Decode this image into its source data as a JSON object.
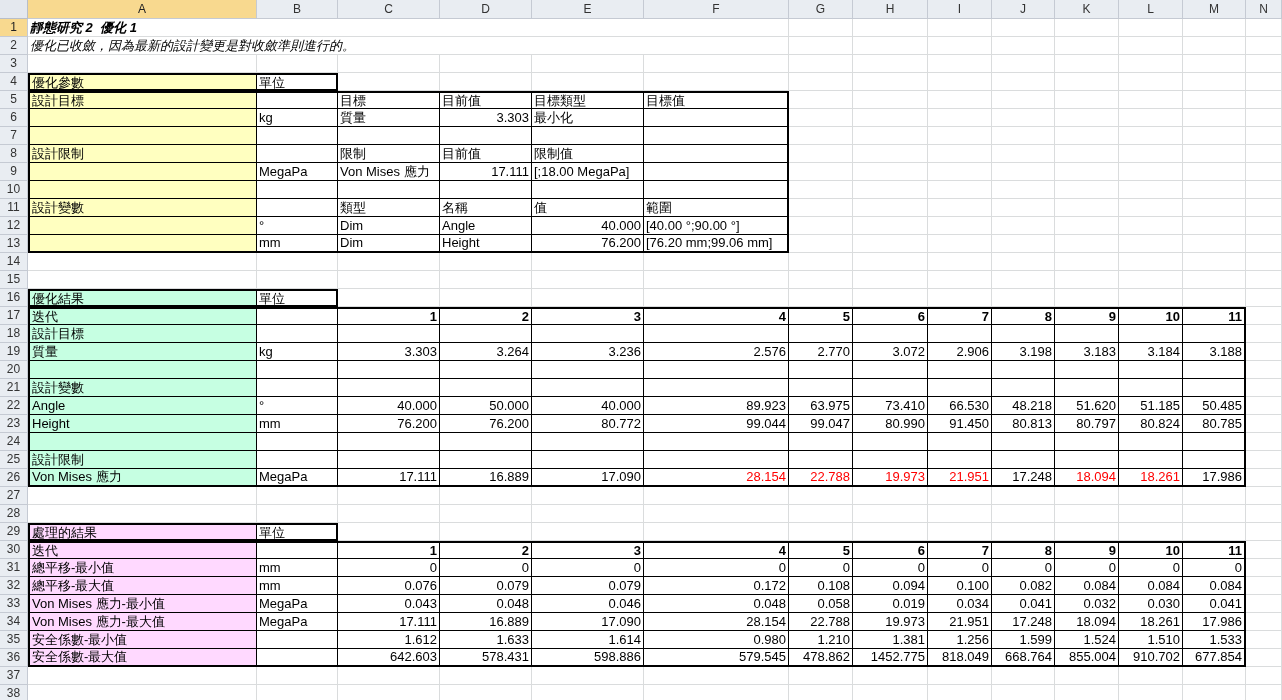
{
  "column_headers": [
    {
      "label": "A",
      "selected": true
    },
    {
      "label": "B",
      "selected": false
    },
    {
      "label": "C",
      "selected": false
    },
    {
      "label": "D",
      "selected": false
    },
    {
      "label": "E",
      "selected": false
    },
    {
      "label": "F",
      "selected": false
    },
    {
      "label": "G",
      "selected": false
    },
    {
      "label": "H",
      "selected": false
    },
    {
      "label": "I",
      "selected": false
    },
    {
      "label": "J",
      "selected": false
    },
    {
      "label": "K",
      "selected": false
    },
    {
      "label": "L",
      "selected": false
    },
    {
      "label": "M",
      "selected": false
    },
    {
      "label": "N",
      "selected": false
    }
  ],
  "row_numbers": [
    {
      "label": "1",
      "selected": true
    },
    {
      "label": "2",
      "selected": false
    },
    {
      "label": "3",
      "selected": false
    },
    {
      "label": "4",
      "selected": false
    },
    {
      "label": "5",
      "selected": false
    },
    {
      "label": "6",
      "selected": false
    },
    {
      "label": "7",
      "selected": false
    },
    {
      "label": "8",
      "selected": false
    },
    {
      "label": "9",
      "selected": false
    },
    {
      "label": "10",
      "selected": false
    },
    {
      "label": "11",
      "selected": false
    },
    {
      "label": "12",
      "selected": false
    },
    {
      "label": "13",
      "selected": false
    },
    {
      "label": "14",
      "selected": false
    },
    {
      "label": "15",
      "selected": false
    },
    {
      "label": "16",
      "selected": false
    },
    {
      "label": "17",
      "selected": false
    },
    {
      "label": "18",
      "selected": false
    },
    {
      "label": "19",
      "selected": false
    },
    {
      "label": "20",
      "selected": false
    },
    {
      "label": "21",
      "selected": false
    },
    {
      "label": "22",
      "selected": false
    },
    {
      "label": "23",
      "selected": false
    },
    {
      "label": "24",
      "selected": false
    },
    {
      "label": "25",
      "selected": false
    },
    {
      "label": "26",
      "selected": false
    },
    {
      "label": "27",
      "selected": false
    },
    {
      "label": "28",
      "selected": false
    },
    {
      "label": "29",
      "selected": false
    },
    {
      "label": "30",
      "selected": false
    },
    {
      "label": "31",
      "selected": false
    },
    {
      "label": "32",
      "selected": false
    },
    {
      "label": "33",
      "selected": false
    },
    {
      "label": "34",
      "selected": false
    },
    {
      "label": "35",
      "selected": false
    },
    {
      "label": "36",
      "selected": false
    },
    {
      "label": "37",
      "selected": false
    },
    {
      "label": "38",
      "selected": false
    }
  ],
  "title": "靜態研究 2  優化 1",
  "message": "優化已收斂，因為最新的設計變更是對收斂準則進行的。",
  "sections": [
    {
      "kind": "parameters",
      "color": "#ffffc0",
      "label": "優化參數",
      "unit": "單位",
      "rows": [
        {
          "label": "設計目標",
          "cells": [
            {
              "kind": "text",
              "text": "目標"
            },
            {
              "kind": "text",
              "text": "目前值"
            },
            {
              "kind": "text",
              "text": "目標類型"
            },
            {
              "kind": "text",
              "text": "目標值"
            }
          ]
        },
        {
          "unit": "kg",
          "cells": [
            {
              "kind": "text",
              "text": "質量"
            },
            {
              "kind": "number",
              "text": "3.303"
            },
            {
              "kind": "text",
              "text": "最小化"
            }
          ]
        },
        {},
        {
          "label": "設計限制",
          "cells": [
            {
              "kind": "text",
              "text": "限制"
            },
            {
              "kind": "text",
              "text": "目前值"
            },
            {
              "kind": "text",
              "text": "限制值"
            }
          ]
        },
        {
          "unit": "MegaPa",
          "cells": [
            {
              "kind": "text",
              "text": "Von Mises 應力"
            },
            {
              "kind": "number",
              "text": "17.111"
            },
            {
              "kind": "text",
              "text": "[;18.00 MegaPa]"
            }
          ]
        },
        {},
        {
          "label": "設計變數",
          "cells": [
            {
              "kind": "text",
              "text": "類型"
            },
            {
              "kind": "text",
              "text": "名稱"
            },
            {
              "kind": "text",
              "text": "值"
            },
            {
              "kind": "text",
              "text": "範圍"
            }
          ]
        },
        {
          "unit": "°",
          "cells": [
            {
              "kind": "text",
              "text": "Dim"
            },
            {
              "kind": "text",
              "text": "Angle"
            },
            {
              "kind": "number",
              "text": "40.000"
            },
            {
              "kind": "text",
              "text": "[40.00 °;90.00 °]"
            }
          ]
        },
        {
          "unit": "mm",
          "cells": [
            {
              "kind": "text",
              "text": "Dim"
            },
            {
              "kind": "text",
              "text": "Height"
            },
            {
              "kind": "number",
              "text": "76.200"
            },
            {
              "kind": "text",
              "text": "[76.20 mm;99.06 mm]"
            }
          ]
        }
      ]
    },
    {
      "kind": "results",
      "color": "#c6ffe2",
      "label": "優化結果",
      "unit": "單位",
      "rows": [
        {
          "kind": "iterations",
          "label": "迭代",
          "values": [
            "1",
            "2",
            "3",
            "4",
            "5",
            "6",
            "7",
            "8",
            "9",
            "10",
            "11"
          ]
        },
        {
          "kind": "data",
          "label": "設計目標"
        },
        {
          "kind": "data",
          "label": "質量",
          "unit": "kg",
          "values": [
            "3.303",
            "3.264",
            "3.236",
            "2.576",
            "2.770",
            "3.072",
            "2.906",
            "3.198",
            "3.183",
            "3.184",
            "3.188"
          ]
        },
        {
          "kind": "blank"
        },
        {
          "kind": "data",
          "label": "設計變數"
        },
        {
          "kind": "data",
          "label": "Angle",
          "unit": "°",
          "values": [
            "40.000",
            "50.000",
            "40.000",
            "89.923",
            "63.975",
            "73.410",
            "66.530",
            "48.218",
            "51.620",
            "51.185",
            "50.485"
          ]
        },
        {
          "kind": "data",
          "label": "Height",
          "unit": "mm",
          "values": [
            "76.200",
            "76.200",
            "80.772",
            "99.044",
            "99.047",
            "80.990",
            "91.450",
            "80.813",
            "80.797",
            "80.824",
            "80.785"
          ]
        },
        {
          "kind": "blank"
        },
        {
          "kind": "data",
          "label": "設計限制"
        },
        {
          "kind": "data",
          "label": "Von Mises 應力",
          "unit": "MegaPa",
          "values": [
            "17.111",
            "16.889",
            "17.090",
            "28.154",
            "22.788",
            "19.973",
            "21.951",
            "17.248",
            "18.094",
            "18.261",
            "17.986"
          ],
          "over_limit": [
            false,
            false,
            false,
            true,
            true,
            true,
            true,
            false,
            true,
            true,
            false
          ]
        }
      ]
    },
    {
      "kind": "results",
      "color": "#ffd9ff",
      "label": "處理的結果",
      "unit": "單位",
      "rows": [
        {
          "kind": "iterations",
          "label": "迭代",
          "values": [
            "1",
            "2",
            "3",
            "4",
            "5",
            "6",
            "7",
            "8",
            "9",
            "10",
            "11"
          ]
        },
        {
          "kind": "data",
          "label": "總平移-最小值",
          "unit": "mm",
          "values": [
            "0",
            "0",
            "0",
            "0",
            "0",
            "0",
            "0",
            "0",
            "0",
            "0",
            "0"
          ]
        },
        {
          "kind": "data",
          "label": "總平移-最大值",
          "unit": "mm",
          "values": [
            "0.076",
            "0.079",
            "0.079",
            "0.172",
            "0.108",
            "0.094",
            "0.100",
            "0.082",
            "0.084",
            "0.084",
            "0.084"
          ]
        },
        {
          "kind": "data",
          "label": "Von Mises 應力-最小值",
          "unit": "MegaPa",
          "values": [
            "0.043",
            "0.048",
            "0.046",
            "0.048",
            "0.058",
            "0.019",
            "0.034",
            "0.041",
            "0.032",
            "0.030",
            "0.041"
          ]
        },
        {
          "kind": "data",
          "label": "Von Mises 應力-最大值",
          "unit": "MegaPa",
          "values": [
            "17.111",
            "16.889",
            "17.090",
            "28.154",
            "22.788",
            "19.973",
            "21.951",
            "17.248",
            "18.094",
            "18.261",
            "17.986"
          ]
        },
        {
          "kind": "data",
          "label": "安全係數-最小值",
          "values": [
            "1.612",
            "1.633",
            "1.614",
            "0.980",
            "1.210",
            "1.381",
            "1.256",
            "1.599",
            "1.524",
            "1.510",
            "1.533"
          ]
        },
        {
          "kind": "data",
          "label": "安全係數-最大值",
          "values": [
            "642.603",
            "578.431",
            "598.886",
            "579.545",
            "478.862",
            "1452.775",
            "818.049",
            "668.764",
            "855.004",
            "910.702",
            "677.854"
          ]
        }
      ]
    }
  ]
}
